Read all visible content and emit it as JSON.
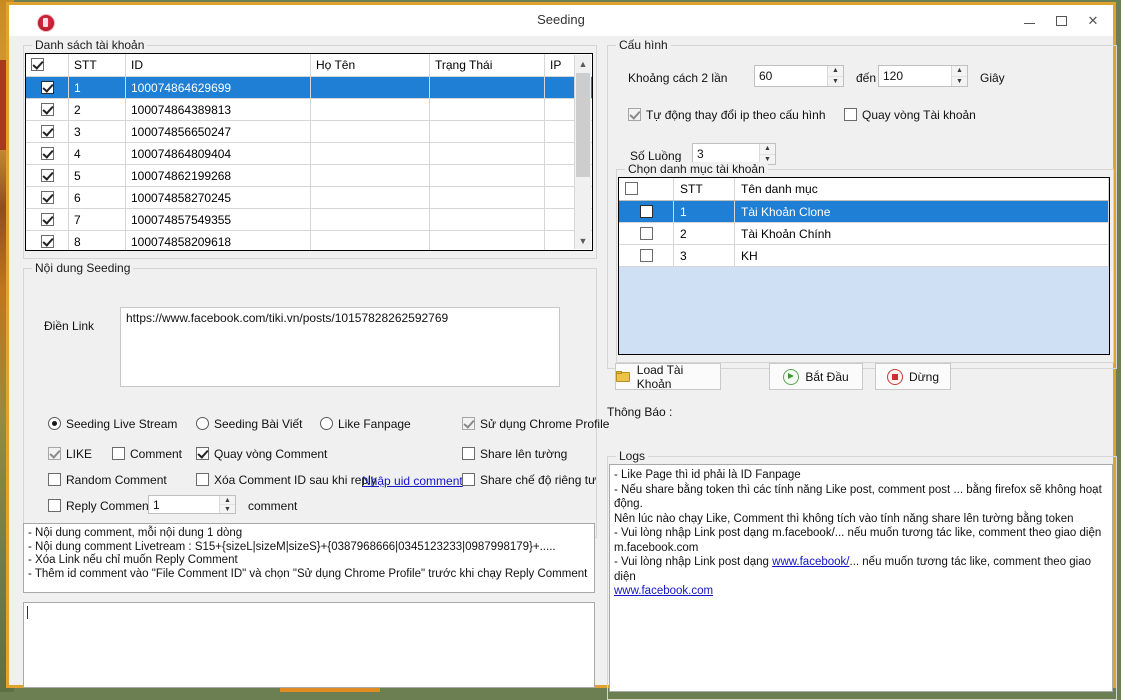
{
  "window": {
    "title": "Seeding",
    "app_icon": "app-circle-icon",
    "minimize": "minimize-icon",
    "maximize": "maximize-icon",
    "close": "close-icon",
    "border_color": "#e0a32e"
  },
  "accounts": {
    "legend": "Danh sách tài khoản",
    "columns": [
      "",
      "STT",
      "ID",
      "Họ Tên",
      "Trạng Thái",
      "IP"
    ],
    "header_checkbox_checked": true,
    "rows": [
      {
        "checked": true,
        "stt": "1",
        "id": "100074864629699",
        "hoten": "",
        "trangthai": "",
        "ip": "",
        "selected": true
      },
      {
        "checked": true,
        "stt": "2",
        "id": "100074864389813",
        "hoten": "",
        "trangthai": "",
        "ip": "",
        "selected": false
      },
      {
        "checked": true,
        "stt": "3",
        "id": "100074856650247",
        "hoten": "",
        "trangthai": "",
        "ip": "",
        "selected": false
      },
      {
        "checked": true,
        "stt": "4",
        "id": "100074864809404",
        "hoten": "",
        "trangthai": "",
        "ip": "",
        "selected": false
      },
      {
        "checked": true,
        "stt": "5",
        "id": "100074862199268",
        "hoten": "",
        "trangthai": "",
        "ip": "",
        "selected": false
      },
      {
        "checked": true,
        "stt": "6",
        "id": "100074858270245",
        "hoten": "",
        "trangthai": "",
        "ip": "",
        "selected": false
      },
      {
        "checked": true,
        "stt": "7",
        "id": "100074857549355",
        "hoten": "",
        "trangthai": "",
        "ip": "",
        "selected": false
      },
      {
        "checked": true,
        "stt": "8",
        "id": "100074858209618",
        "hoten": "",
        "trangthai": "",
        "ip": "",
        "selected": false
      }
    ],
    "scrollbar": {
      "up": "chevron-up-icon",
      "down": "chevron-down-icon"
    }
  },
  "seeding": {
    "legend": "Nội dung Seeding",
    "link_label": "Điền Link",
    "link_value": "https://www.facebook.com/tiki.vn/posts/10157828262592769",
    "modes": [
      {
        "label": "Seeding Live Stream",
        "selected": true
      },
      {
        "label": "Seeding Bài Viết",
        "selected": false
      },
      {
        "label": "Like Fanpage",
        "selected": false
      }
    ],
    "chrome_profile": {
      "label": "Sử dụng Chrome Profile",
      "checked": true,
      "disabled": true
    },
    "like": {
      "label": "LIKE",
      "checked": true,
      "disabled": true
    },
    "comment": {
      "label": "Comment",
      "checked": false
    },
    "quay_vong_comment": {
      "label": "Quay vòng Comment",
      "checked": true
    },
    "share_len_tuong": {
      "label": "Share lên tường",
      "checked": false
    },
    "random_comment": {
      "label": "Random Comment",
      "checked": false
    },
    "xoa_comment_id": {
      "label": "Xóa Comment ID sau khi reply",
      "checked": false
    },
    "nhap_uid_link": "Nhập uid comment",
    "share_rieng_tu": {
      "label": "Share chế độ riêng tư",
      "checked": false
    },
    "reply_comment": {
      "label": "Reply Comment",
      "checked": false,
      "value": "1",
      "unit": "comment"
    },
    "help_lines": [
      "- Nội dung comment, mỗi nội dung 1 dòng",
      "- Nội dung comment Livetream : S15+{sizeL|sizeM|sizeS}+{0387968666|0345123233|0987998179}+.....",
      "- Xóa Link nếu chỉ muốn Reply Comment",
      "- Thêm id comment vào \"File Comment ID\" và chọn \"Sử dụng Chrome Profile\" trước khi chạy Reply Comment"
    ]
  },
  "config": {
    "legend": "Cấu hình",
    "interval_label": "Khoảng cách 2 lần",
    "interval_from": "60",
    "interval_to": "120",
    "between_label": "đến",
    "unit_label": "Giây",
    "auto_ip": {
      "label": "Tự động thay đổi ip theo cấu hình",
      "checked": true,
      "disabled": true
    },
    "quay_vong_tk": {
      "label": "Quay vòng Tài khoản",
      "checked": false
    },
    "threads_label": "Số Luồng",
    "threads_value": "3",
    "category": {
      "legend": "Chọn danh mục tài khoản",
      "columns": [
        "",
        "STT",
        "Tên danh mục"
      ],
      "header_checkbox_checked": false,
      "rows": [
        {
          "checked": false,
          "stt": "1",
          "name": "Tài Khoản Clone",
          "selected": true
        },
        {
          "checked": false,
          "stt": "2",
          "name": "Tài Khoản Chính",
          "selected": false
        },
        {
          "checked": false,
          "stt": "3",
          "name": "KH",
          "selected": false
        }
      ]
    }
  },
  "actions": {
    "load": {
      "label": "Load Tài Khoản",
      "icon": "folder-icon"
    },
    "start": {
      "label": "Bắt Đầu",
      "icon": "play-icon"
    },
    "stop": {
      "label": "Dừng",
      "icon": "stop-icon"
    }
  },
  "notice": {
    "label": "Thông Báo :",
    "value": ""
  },
  "logs": {
    "legend": "Logs",
    "lines": [
      "- Like Page thì id phải là ID Fanpage",
      "- Nếu share bằng token thì các tính năng Like post, comment post ... bằng firefox sẽ không hoạt động.",
      "Nên lúc nào chạy Like, Comment thì không tích vào tính năng share lên tường bằng token",
      "- Vui lòng nhập Link post dạng m.facebook/... nếu muốn tương tác like, comment theo giao diện",
      "m.facebook.com",
      "- Vui lòng nhập Link post dạng www.facebook/... nếu muốn tương tác like, comment theo giao diện",
      "www.facebook.com"
    ],
    "link_1": "www.facebook/",
    "link_2": "www.facebook.com"
  }
}
